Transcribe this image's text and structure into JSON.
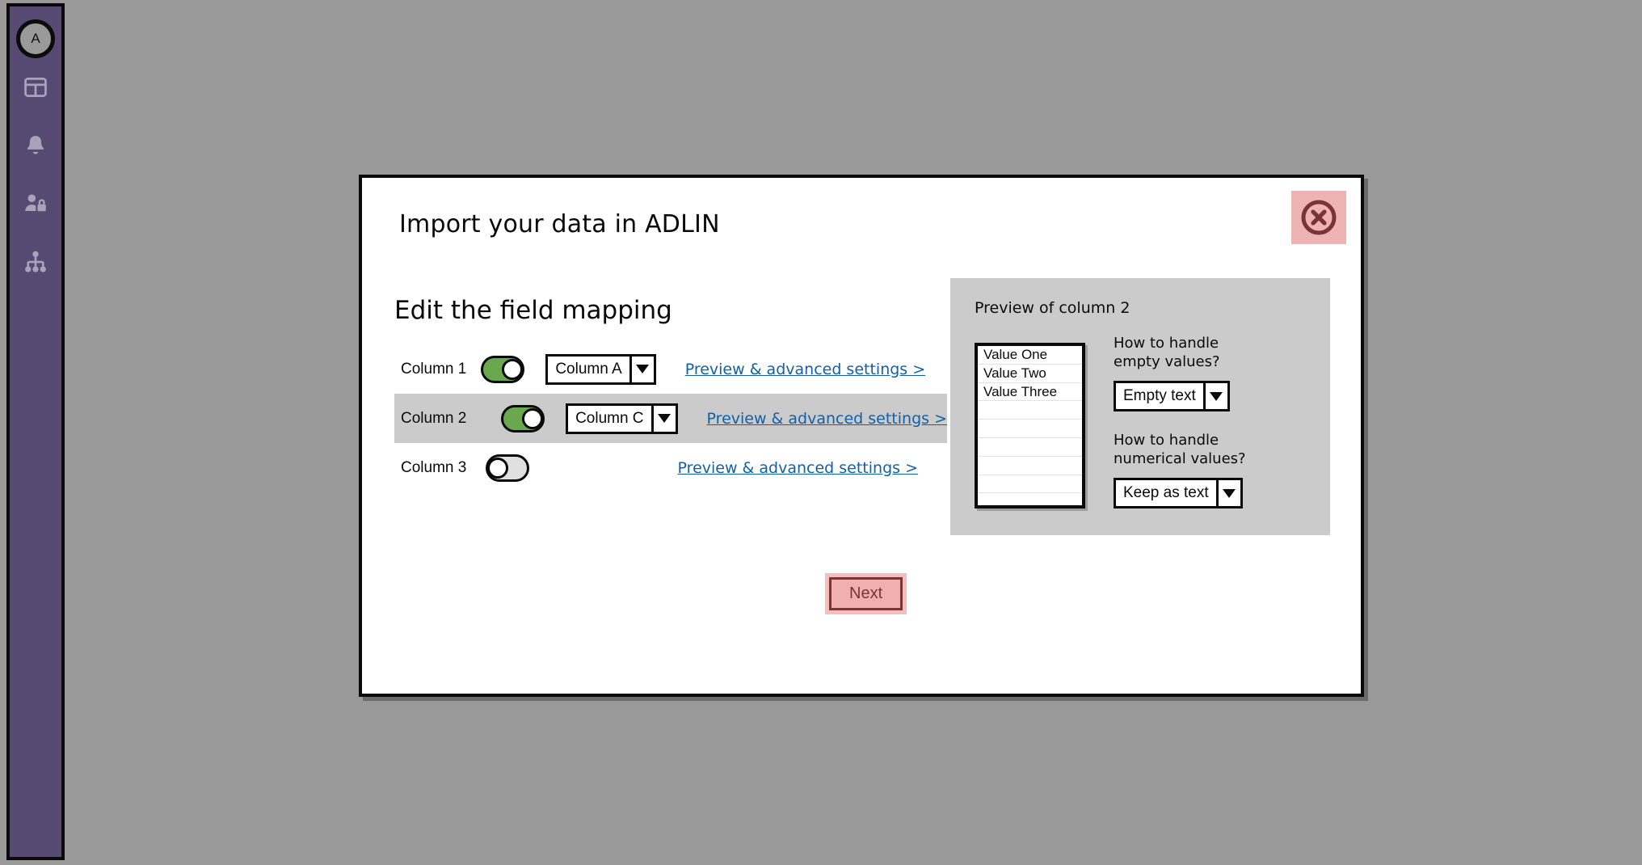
{
  "theme": {
    "page_bg": "#999999",
    "sidebar_bg": "#564a72",
    "accent_link": "#1260a8",
    "toggle_on": "#6aa84f",
    "danger": "#7b3434",
    "danger_bg": "#f0b0b0",
    "panel_gray": "#cbcbcb"
  },
  "sidebar": {
    "avatar_label": "A",
    "items": [
      {
        "icon": "grid-dashboard-icon",
        "name": "dashboard"
      },
      {
        "icon": "bell-notifications-icon",
        "name": "notifications"
      },
      {
        "icon": "user-lock-permissions-icon",
        "name": "permissions"
      },
      {
        "icon": "hierarchy-sitemap-icon",
        "name": "organization"
      }
    ]
  },
  "dialog": {
    "title": "Import your data in ADLIN",
    "close_icon": "circle-x-close-icon",
    "section_heading": "Edit the field mapping",
    "next_label": "Next"
  },
  "mapping": {
    "link_label": "Preview & advanced settings >",
    "rows": [
      {
        "label": "Column 1",
        "enabled": true,
        "has_dropdown": true,
        "dropdown_value": "Column A",
        "selected": false
      },
      {
        "label": "Column 2",
        "enabled": true,
        "has_dropdown": true,
        "dropdown_value": "Column C",
        "selected": true
      },
      {
        "label": "Column 3",
        "enabled": false,
        "has_dropdown": false,
        "dropdown_value": "",
        "selected": false
      }
    ]
  },
  "preview": {
    "title": "Preview of column 2",
    "values": [
      "Value One",
      "Value Two",
      "Value Three"
    ],
    "empty_rows": 6,
    "empty_values": {
      "label": "How to handle\nempty values?",
      "value": "Empty text"
    },
    "numerical_values": {
      "label": "How to handle\nnumerical values?",
      "value": "Keep as text"
    }
  }
}
